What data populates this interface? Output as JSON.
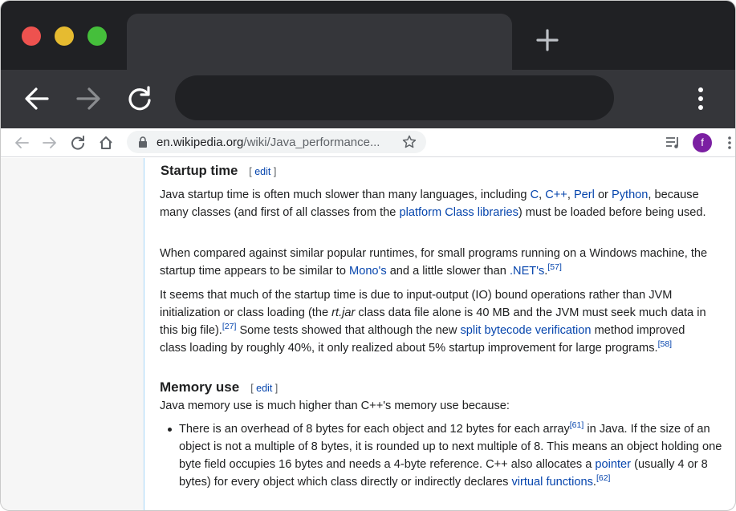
{
  "browser": {
    "address_url_host": "en.wikipedia.org",
    "address_url_path": "/wiki/Java_performance...",
    "avatar_letter": "f",
    "accent_avatar": "#7b1fa2"
  },
  "article": {
    "startup": {
      "heading": "Startup time",
      "edit_open": "[ ",
      "edit_label": "edit",
      "edit_close": " ]",
      "p1_a": "Java startup time is often much slower than many languages, including ",
      "p1_c": "C",
      "p1_sep1": ", ",
      "p1_cpp": "C++",
      "p1_sep2": ", ",
      "p1_perl": "Perl",
      "p1_or": " or ",
      "p1_python": "Python",
      "p1_b": ", because many classes (and first of all classes from the ",
      "p1_platform": "platform Class libraries",
      "p1_end": ") must be loaded before being used.",
      "p2_a": "When compared against similar popular runtimes, for small programs running on a Windows machine, the startup time appears to be similar to ",
      "p2_mono": "Mono's",
      "p2_b": " and a little slower than ",
      "p2_net": ".NET's",
      "p2_end": ".",
      "p2_ref": "[57]",
      "p3_a": "It seems that much of the startup time is due to input-output (IO) bound operations rather than JVM initialization or class loading (the ",
      "p3_rtjar": "rt.jar",
      "p3_b": " class data file alone is 40 MB and the JVM must seek much data in this big file).",
      "p3_ref1": "[27]",
      "p3_c": " Some tests showed that although the new ",
      "p3_split": "split bytecode verification",
      "p3_d": " method improved class loading by roughly 40%, it only realized about 5% startup improvement for large programs.",
      "p3_ref2": "[58]"
    },
    "memory": {
      "heading": "Memory use",
      "edit_open": "[ ",
      "edit_label": "edit",
      "edit_close": " ]",
      "intro": "Java memory use is much higher than C++'s memory use because:",
      "li1_a": "There is an overhead of 8 bytes for each object and 12 bytes for each array",
      "li1_ref1": "[61]",
      "li1_b": " in Java. If the size of an object is not a multiple of 8 bytes, it is rounded up to next multiple of 8. This means an object holding one byte field occupies 16 bytes and needs a 4-byte reference. C++ also allocates a ",
      "li1_pointer": "pointer",
      "li1_c": " (usually 4 or 8 bytes) for every object which class directly or indirectly declares ",
      "li1_virtual": "virtual functions",
      "li1_end": ".",
      "li1_ref2": "[62]"
    }
  }
}
